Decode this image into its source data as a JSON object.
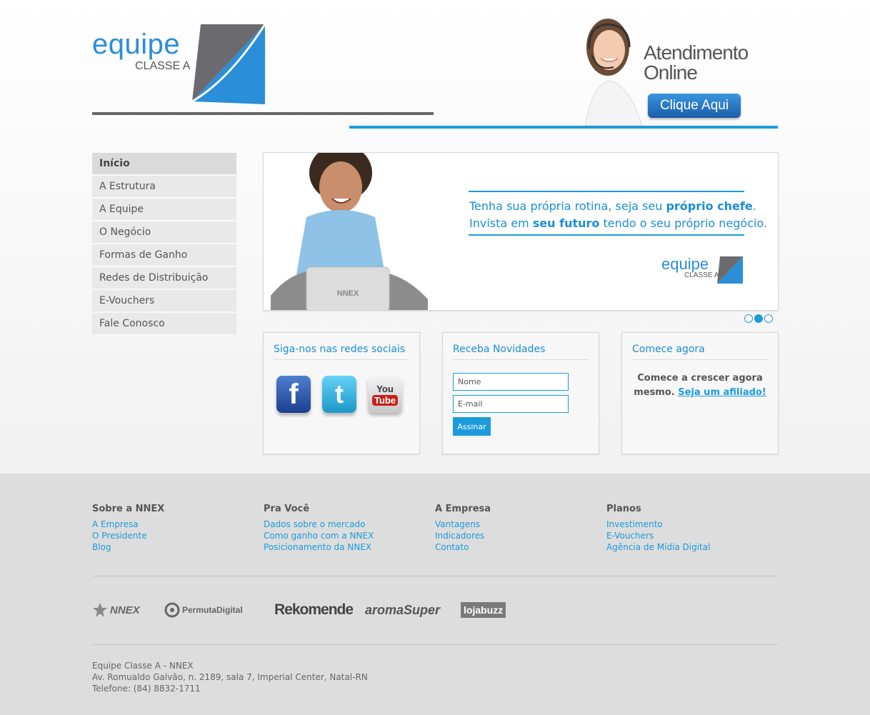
{
  "header": {
    "logo_word": "equipe",
    "logo_sub": "CLASSE A",
    "banner_line1": "Atendimento",
    "banner_line2": "Online",
    "banner_cta": "Clique Aqui"
  },
  "nav": [
    "Início",
    "A Estrutura",
    "A Equipe",
    "O Negócio",
    "Formas de Ganho",
    "Redes de Distribuição",
    "E-Vouchers",
    "Fale Conosco"
  ],
  "slider": {
    "line1_a": "Tenha sua própria rotina, seja seu ",
    "line1_b": "próprio chefe",
    "line1_c": ".",
    "line2_a": "Invista em ",
    "line2_b": "seu futuro",
    "line2_c": " tendo o seu próprio negócio.",
    "laptop_brand": "NNEX",
    "logo_word": "equipe",
    "logo_sub": "CLASSE A",
    "dot_count": 3,
    "active_dot": 2
  },
  "widgets": {
    "social": {
      "title": "Siga-nos nas redes sociais",
      "icons": [
        "facebook-icon",
        "twitter-icon",
        "youtube-icon"
      ],
      "youtube_you": "You",
      "youtube_tube": "Tube"
    },
    "newsletter": {
      "title": "Receba Novidades",
      "name_placeholder": "Nome",
      "email_placeholder": "E-mail",
      "button": "Assinar"
    },
    "start": {
      "title": "Comece agora",
      "text": "Comece a crescer agora mesmo. ",
      "link": "Seja um afiliado!"
    }
  },
  "footer": {
    "columns": [
      {
        "title": "Sobre a NNEX",
        "links": [
          "A Empresa",
          "O Presidente",
          "Blog"
        ]
      },
      {
        "title": "Pra Você",
        "links": [
          "Dados sobre o mercado",
          "Como ganho com a NNEX",
          "Posicionamento da NNEX"
        ]
      },
      {
        "title": "A Empresa",
        "links": [
          "Vantagens",
          "Indicadores",
          "Contato"
        ]
      },
      {
        "title": "Planos",
        "links": [
          "Investimento",
          "E-Vouchers",
          "Agência de Mídia Digital"
        ]
      }
    ],
    "partners": [
      "NNEX",
      "PermutaDigital",
      "Rekomende",
      "aromaSuper",
      "lojabuzz"
    ],
    "address": [
      "Equipe Classe A - NNEX",
      "Av. Romualdo Galvão, n. 2189, sala 7, Imperial Center, Natal-RN",
      "Telefone: (84) 8832-1711"
    ]
  },
  "colors": {
    "accent": "#1b9bdc",
    "nav_bg": "#e9e9e9",
    "footer_bg": "#dddddd"
  }
}
